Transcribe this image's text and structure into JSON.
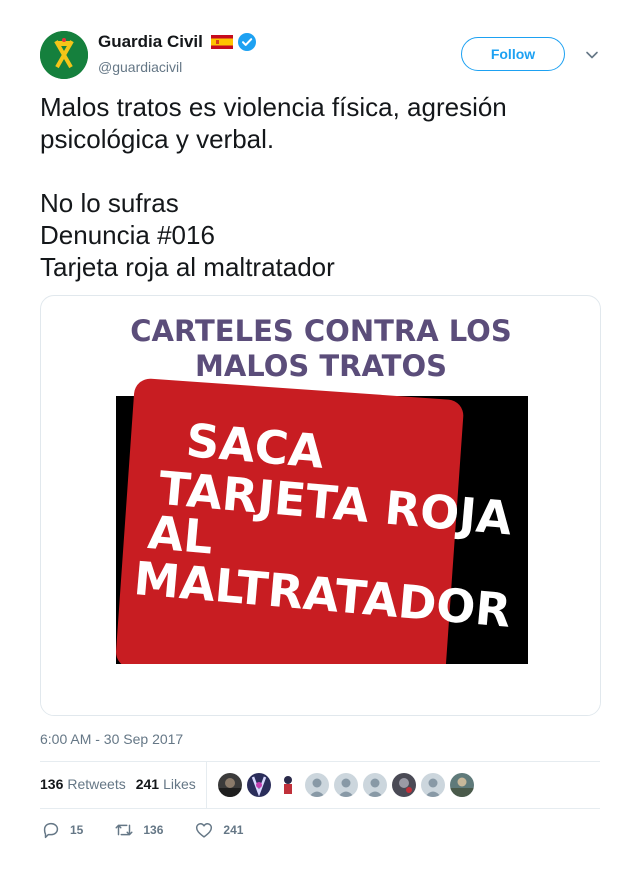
{
  "header": {
    "display_name": "Guardia Civil",
    "handle": "@guardiacivil",
    "follow_label": "Follow",
    "avatar_icon": "guardia-civil-emblem",
    "flag_icon": "spain-flag-icon",
    "verified_icon": "verified-badge-icon",
    "colors": {
      "accent": "#1da1f2",
      "avatar_bg": "#15803d"
    }
  },
  "tweet": {
    "lines": [
      "Malos tratos es violencia física, agresión",
      "psicológica y verbal.",
      "",
      "No lo sufras",
      "Denuncia #016",
      "Tarjeta roja al maltratador"
    ]
  },
  "media": {
    "heading_line1": "CARTELES CONTRA LOS",
    "heading_line2": "MALOS TRATOS",
    "card_line1": "SACA",
    "card_line2": "TARJETA ROJA",
    "card_line3": "AL",
    "card_line4": "MALTRATADOR",
    "colors": {
      "heading": "#5b4d7a",
      "card_red": "#c81d22",
      "background": "#000000"
    }
  },
  "timestamp": "6:00 AM - 30 Sep 2017",
  "stats": {
    "retweets_count": "136",
    "retweets_label": "Retweets",
    "likes_count": "241",
    "likes_label": "Likes"
  },
  "actions": {
    "reply_count": "15",
    "retweet_count": "136",
    "like_count": "241",
    "reply_icon": "reply-icon",
    "retweet_icon": "retweet-icon",
    "like_icon": "heart-icon"
  }
}
